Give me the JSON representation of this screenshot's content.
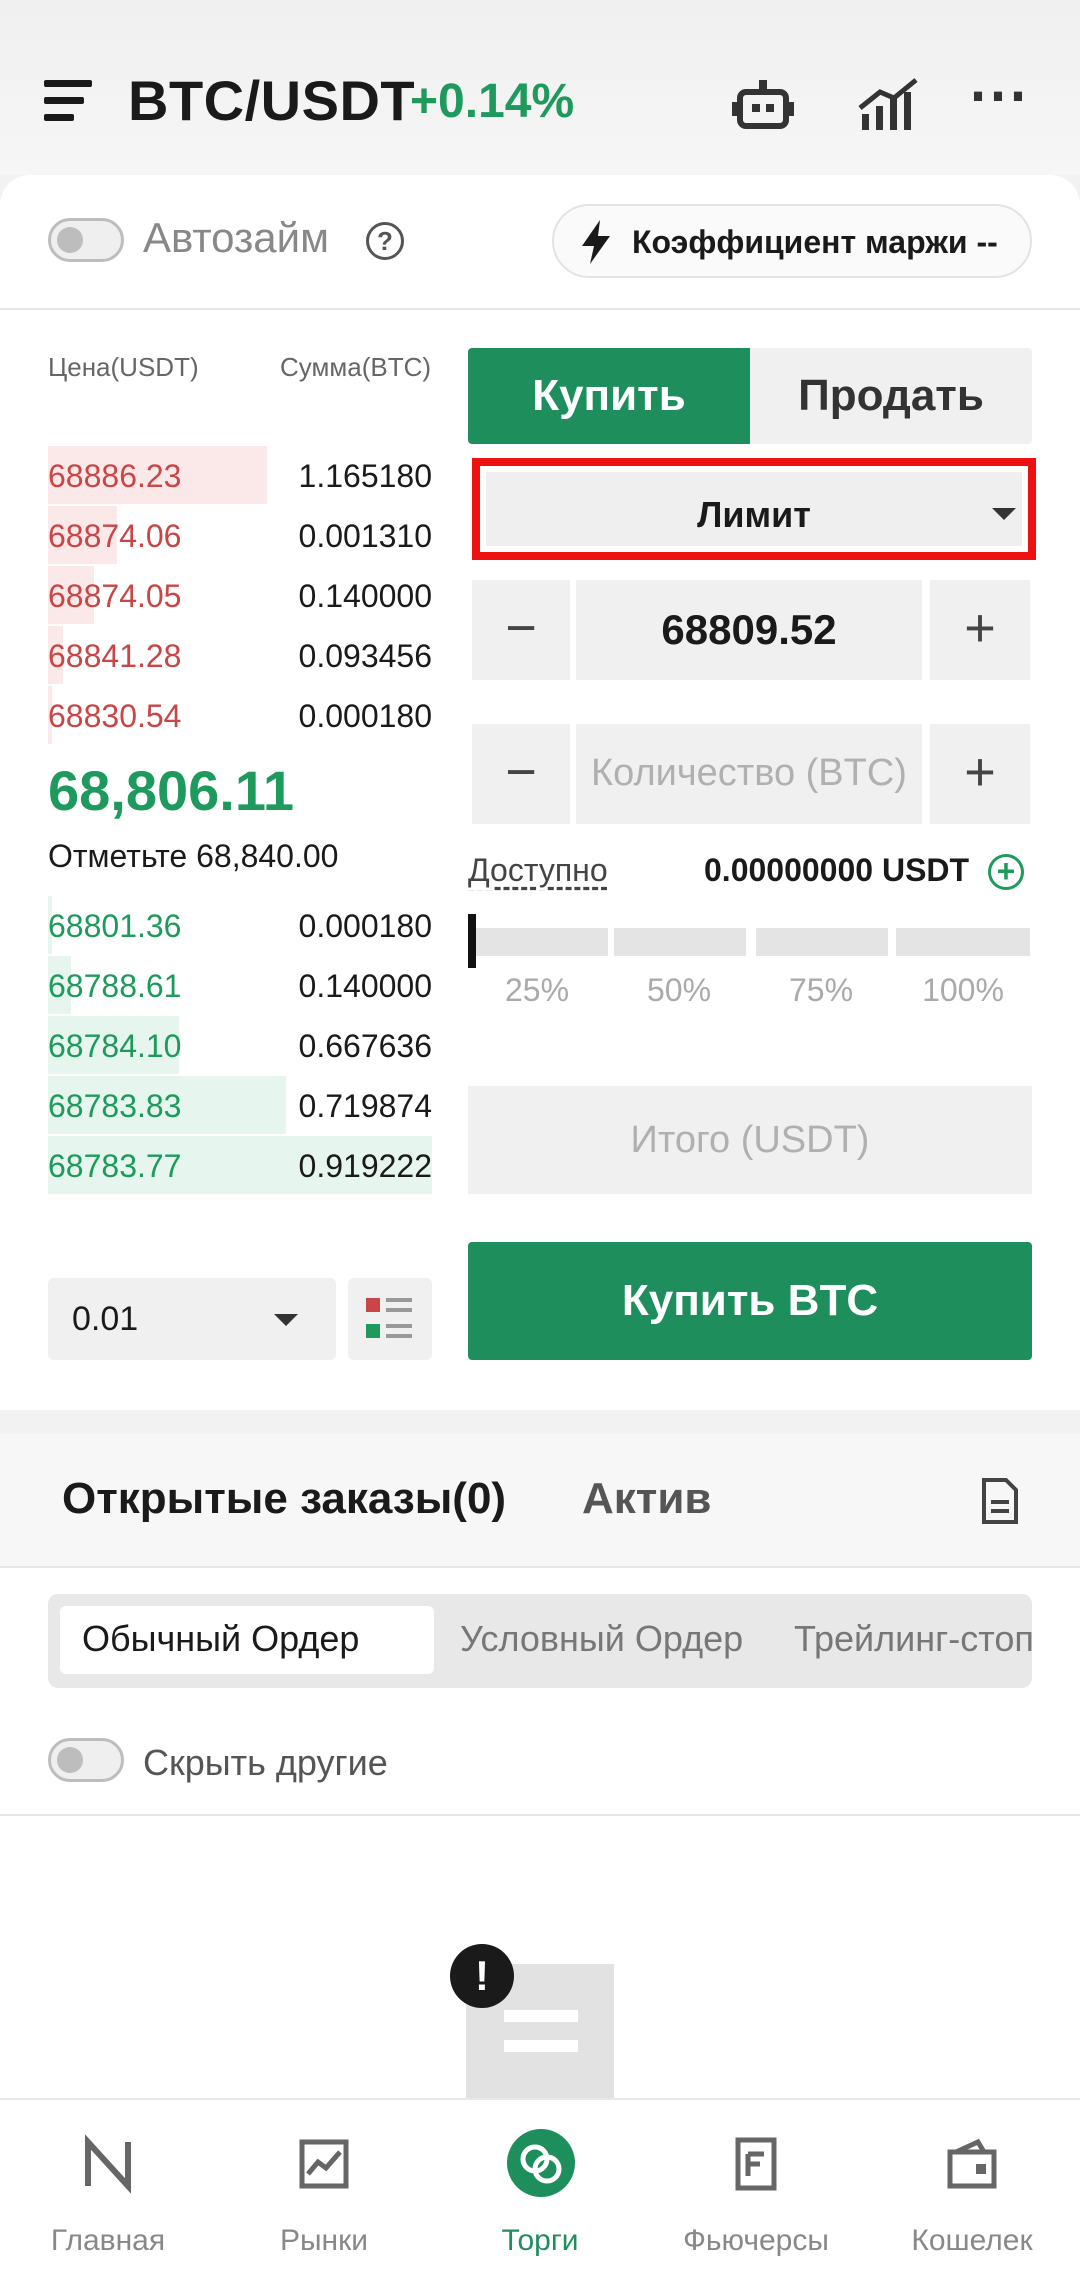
{
  "header": {
    "pair": "BTC/USDT",
    "change": "+0.14%",
    "icons": [
      "menu-icon",
      "bot-icon",
      "chart-icon",
      "more-icon"
    ],
    "more_glyph": "⋯"
  },
  "margin_bar": {
    "auto_borrow_label": "Автозайм",
    "help_glyph": "?",
    "margin_ratio_label": "Коэффициент маржи --"
  },
  "order_book": {
    "price_header": "Цена(USDT)",
    "amount_header": "Сумма(BTC)",
    "asks": [
      {
        "price": "68886.23",
        "amount": "1.165180",
        "depth": 0.57
      },
      {
        "price": "68874.06",
        "amount": "0.001310",
        "depth": 0.18
      },
      {
        "price": "68874.05",
        "amount": "0.140000",
        "depth": 0.12
      },
      {
        "price": "68841.28",
        "amount": "0.093456",
        "depth": 0.04
      },
      {
        "price": "68830.54",
        "amount": "0.000180",
        "depth": 0.01
      }
    ],
    "last_price": "68,806.11",
    "mark_price": "Отметьте 68,840.00",
    "bids": [
      {
        "price": "68801.36",
        "amount": "0.000180",
        "depth": 0.01
      },
      {
        "price": "68788.61",
        "amount": "0.140000",
        "depth": 0.06
      },
      {
        "price": "68784.10",
        "amount": "0.667636",
        "depth": 0.34
      },
      {
        "price": "68783.83",
        "amount": "0.719874",
        "depth": 0.62
      },
      {
        "price": "68783.77",
        "amount": "0.919222",
        "depth": 1.0
      }
    ],
    "precision": "0.01"
  },
  "trade_form": {
    "buy_tab": "Купить",
    "sell_tab": "Продать",
    "order_type": "Лимит",
    "price_value": "68809.52",
    "minus_glyph": "−",
    "plus_glyph": "+",
    "quantity_placeholder": "Количество (BTC)",
    "available_label": "Доступно",
    "available_value": "0.00000000 USDT",
    "add_glyph": "+",
    "slider_labels": [
      "25%",
      "50%",
      "75%",
      "100%"
    ],
    "slider_fill": 0,
    "total_placeholder": "Итого (USDT)",
    "submit_label": "Купить BTC"
  },
  "orders": {
    "open_orders_tab": "Открытые заказы(0)",
    "assets_tab": "Актив",
    "subtabs": [
      "Обычный Ордер",
      "Условный Ордер",
      "Трейлинг-стоп"
    ],
    "hide_others_label": "Скрыть другие",
    "empty_mark": "!"
  },
  "nav": {
    "items": [
      "Главная",
      "Рынки",
      "Торги",
      "Фьючерсы",
      "Кошелек"
    ],
    "active_index": 2
  },
  "colors": {
    "accent_green": "#1e8f5c",
    "up_green": "#1e9a5c",
    "down_red": "#c84646",
    "highlight_red": "#ee1111"
  }
}
